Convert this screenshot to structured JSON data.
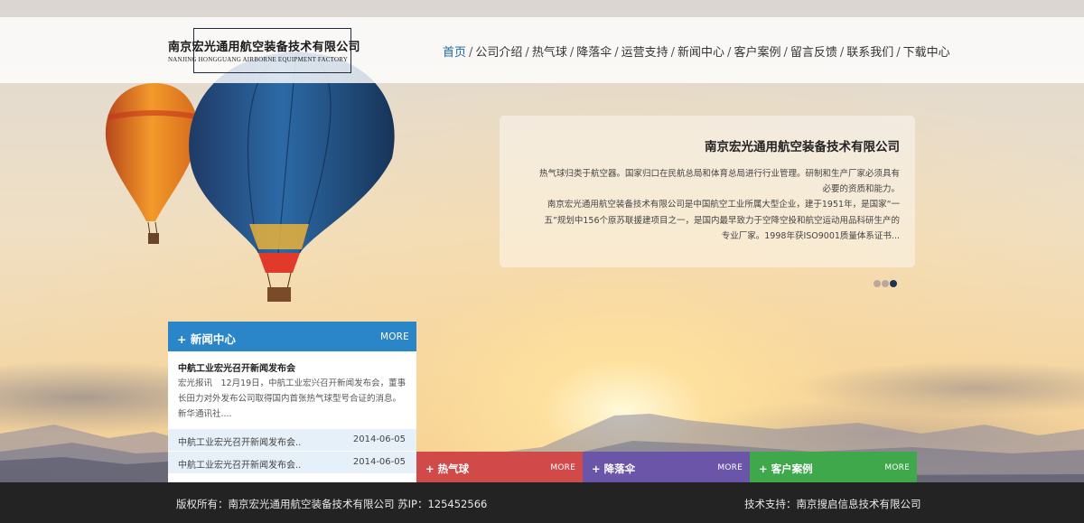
{
  "colors": {
    "accent_blue": "#2a86c9",
    "nav_active": "#1a66a6",
    "tile_red": "#d14a4a",
    "tile_purple": "#6a55a8",
    "tile_green": "#3fa84a",
    "footer_bg": "#232323"
  },
  "header": {
    "logo_cn": "南京宏光通用航空装备技术有限公司",
    "logo_en": "Nanjing Hongguang Airborne Equipment Factory"
  },
  "nav": {
    "items": [
      "首页",
      "公司介绍",
      "热气球",
      "降落伞",
      "运营支持",
      "新闻中心",
      "客户案例",
      "留言反馈",
      "联系我们",
      "下载中心"
    ],
    "separator": "/"
  },
  "intro": {
    "title": "南京宏光通用航空装备技术有限公司",
    "paragraph1": "热气球归类于航空器。国家归口在民航总局和体育总局进行行业管理。研制和生产厂家必须具有必要的资质和能力。",
    "paragraph2": "南京宏光通用航空装备技术有限公司是中国航空工业所属大型企业，建于1951年，是国家“一五”规划中156个原苏联援建项目之一，是国内最早致力于空降空投和航空运动用品科研生产的专业厂家。1998年获ISO9001质量体系证书..."
  },
  "news": {
    "title": "+ 新闻中心",
    "more": "MORE",
    "feature_title": "中航工业宏光召开新闻发布会",
    "feature_text": "宏光报讯　12月19日，中航工业宏兴召开新闻发布会，董事长田力对外发布公司取得国内首张热气球型号合证的消息。新华通讯社....",
    "items": [
      {
        "title": "中航工业宏光召开新闻发布会..",
        "date": "2014-06-05"
      },
      {
        "title": "中航工业宏光召开新闻发布会..",
        "date": "2014-06-05"
      }
    ]
  },
  "tiles": [
    {
      "title": "+ 热气球",
      "more": "MORE"
    },
    {
      "title": "+ 降落伞",
      "more": "MORE"
    },
    {
      "title": "+ 客户案例",
      "more": "MORE"
    }
  ],
  "footer": {
    "copyright": "版权所有：南京宏光通用航空装备技术有限公司  苏IP：125452566",
    "support": "技术支持：南京搜启信息技术有限公司"
  }
}
